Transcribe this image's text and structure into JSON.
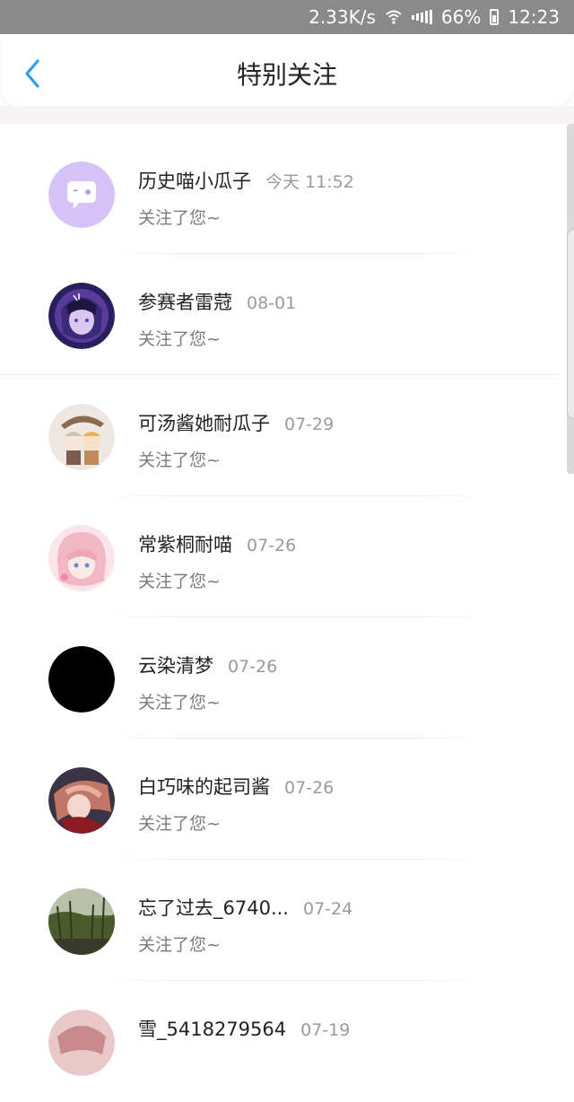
{
  "status_bar": {
    "speed": "2.33K/s",
    "battery": "66%",
    "time": "12:23"
  },
  "header": {
    "title": "特别关注"
  },
  "items": [
    {
      "name": "历史喵小瓜子",
      "date": "今天 11:52",
      "desc": "关注了您~"
    },
    {
      "name": "参赛者雷蒄",
      "date": "08-01",
      "desc": "关注了您~"
    },
    {
      "name": "可汤酱她耐瓜子",
      "date": "07-29",
      "desc": "关注了您~"
    },
    {
      "name": "常紫桐耐喵",
      "date": "07-26",
      "desc": "关注了您~"
    },
    {
      "name": "云染清梦",
      "date": "07-26",
      "desc": "关注了您~"
    },
    {
      "name": "白巧味的起司酱",
      "date": "07-26",
      "desc": "关注了您~"
    },
    {
      "name": "忘了过去_6740...",
      "date": "07-24",
      "desc": "关注了您~"
    },
    {
      "name": "雪_5418279564",
      "date": "07-19",
      "desc": ""
    }
  ],
  "colors": {
    "accent": "#2b9ef5",
    "title": "#222222",
    "secondary": "#9a9a9a"
  }
}
